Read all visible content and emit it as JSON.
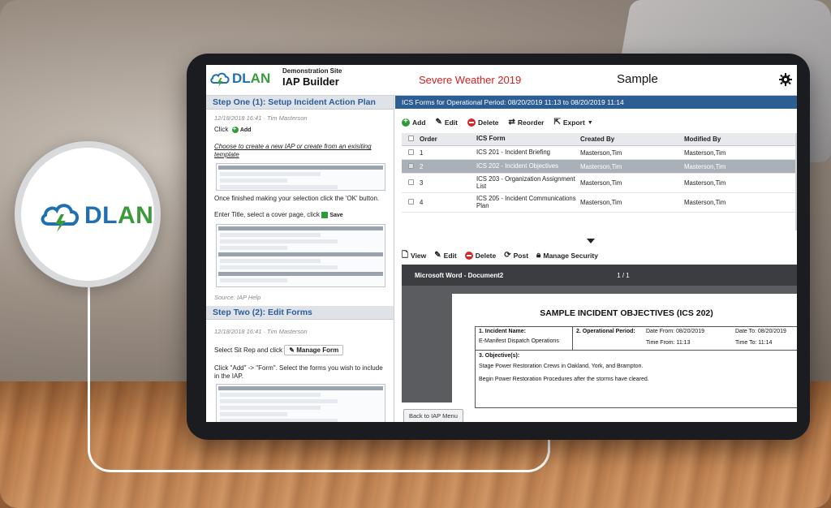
{
  "logo": {
    "text_d": "DL",
    "text_an": "AN"
  },
  "header": {
    "site_label": "Demonstration Site",
    "app_name": "IAP Builder",
    "incident": "Severe Weather 2019",
    "sample": "Sample",
    "colors": {
      "incident": "#d1201f",
      "brand_blue": "#1f6fb2",
      "brand_green": "#3a9a3c"
    }
  },
  "left": {
    "step1": {
      "title": "Step One (1): Setup Incident Action Plan",
      "meta": "12/18/2018 16:41 · Tim Masterson",
      "click": "Click",
      "add": "Add",
      "choose": "Choose to create a new IAP or create from an exisiting template",
      "finished": "Once finished making your selection click the 'OK' button.",
      "enter_title": "Enter Title, select a cover page, click",
      "save": "Save",
      "source": "Source: IAP Help"
    },
    "step2": {
      "title": "Step Two (2): Edit Forms",
      "meta": "12/18/2018 16:41 · Tim Masterson",
      "select": "Select Sit Rep and click",
      "manage_form": "Manage Form",
      "instr": "Click \"Add\" -> \"Form\". Select the forms you wish to include in the IAP."
    }
  },
  "right": {
    "title": "ICS Forms for Operational Period: 08/20/2019 11:13 to 08/20/2019 11:14",
    "toolbar": {
      "add": "Add",
      "edit": "Edit",
      "delete": "Delete",
      "reorder": "Reorder",
      "export": "Export"
    },
    "columns": {
      "order": "Order",
      "form": "ICS Form",
      "created": "Created By",
      "modified": "Modified By"
    },
    "rows": [
      {
        "order": "1",
        "form": "ICS 201 - Incident Briefing",
        "created": "Masterson,Tim",
        "modified": "Masterson,Tim"
      },
      {
        "order": "2",
        "form": "ICS 202 - Incident Objectives",
        "created": "Masterson,Tim",
        "modified": "Masterson,Tim"
      },
      {
        "order": "3",
        "form": "ICS 203 - Organization Assignment List",
        "created": "Masterson,Tim",
        "modified": "Masterson,Tim"
      },
      {
        "order": "4",
        "form": "ICS 205 - Incident Communications Plan",
        "created": "Masterson,Tim",
        "modified": "Masterson,Tim"
      }
    ],
    "toolbar2": {
      "view": "View",
      "edit": "Edit",
      "delete": "Delete",
      "post": "Post",
      "security": "Manage Security"
    },
    "viewer": {
      "doc_name": "Microsoft Word - Document2",
      "pages": "1 / 1",
      "doc_title": "SAMPLE INCIDENT OBJECTIVES (ICS 202)",
      "f1_label": "1. Incident Name:",
      "f1_value": "E-Manifest Dispatch Operations",
      "f2_label": "2. Operational Period:",
      "date_from": "Date From:  08/20/2019",
      "date_to": "Date To:   08/20/2019",
      "time_from": "Time From:  11:13",
      "time_to": "Time To:   11:14",
      "f3_label": "3. Objective(s):",
      "obj1": "Stage Power Restoration Crews in Oakland, York, and Brampton.",
      "obj2": "Begin Power Restoration Procedures after the storms have cleared."
    },
    "back": "Back to IAP Menu"
  }
}
